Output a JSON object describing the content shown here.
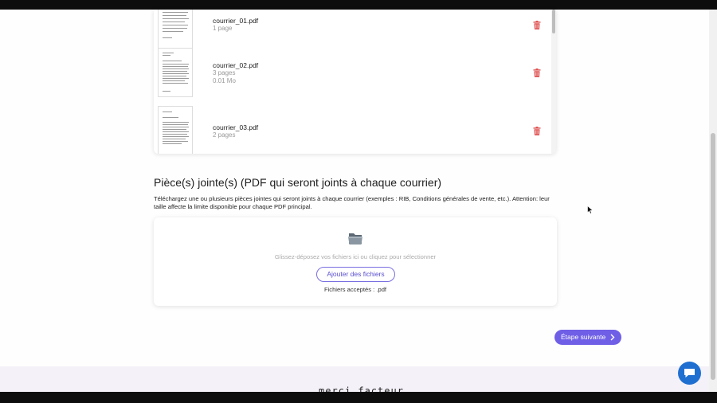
{
  "files": [
    {
      "name": "courrier_01.pdf",
      "pages": "1 page",
      "size": ""
    },
    {
      "name": "courrier_02.pdf",
      "pages": "3 pages",
      "size": "0.01 Mo"
    },
    {
      "name": "courrier_03.pdf",
      "pages": "2 pages",
      "size": ""
    }
  ],
  "attachments": {
    "title": "Pièce(s) jointe(s) (PDF qui seront joints à chaque courrier)",
    "description": "Téléchargez une ou plusieurs pièces jointes qui seront joints à chaque courrier (exemples : RIB, Conditions générales de vente, etc.). Attention: leur taille affecte la limite disponible pour chaque PDF principal.",
    "drop_hint": "Glissez-déposez vos fichiers ici ou cliquez pour sélectionner",
    "add_button": "Ajouter des fichiers",
    "accepted": "Fichiers acceptés : .pdf"
  },
  "next_button": "Étape suivante",
  "footer": {
    "logo": "merci facteur"
  },
  "colors": {
    "accent": "#6f5fe6",
    "delete": "#e05555",
    "chat": "#1f6fd1"
  },
  "icons": [
    "trash-icon",
    "folder-icon",
    "chevron-right-icon",
    "chat-icon"
  ]
}
